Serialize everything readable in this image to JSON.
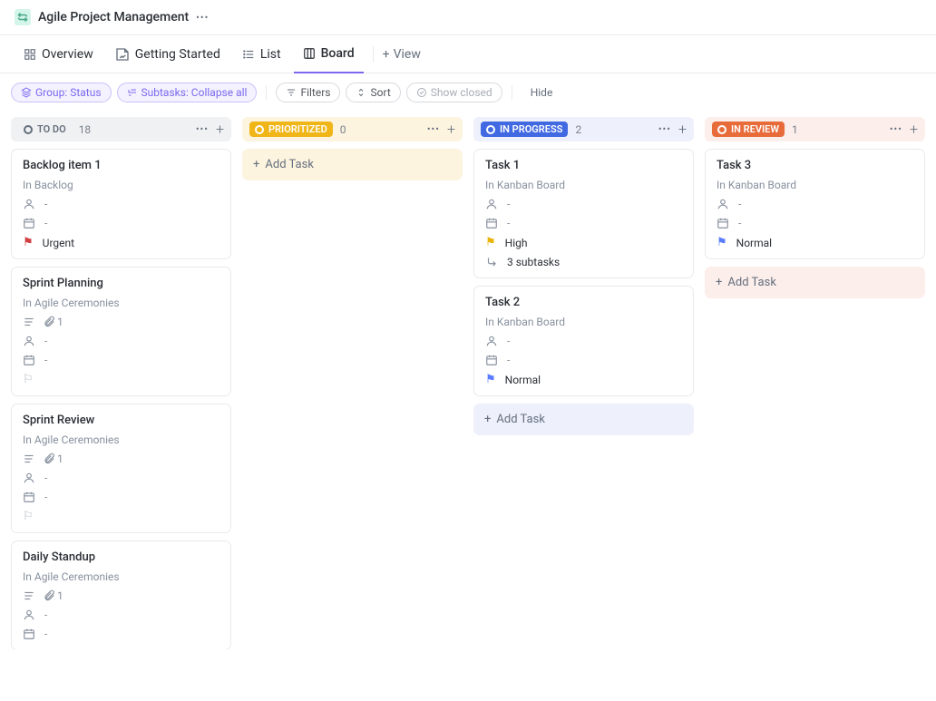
{
  "header": {
    "title": "Agile Project Management"
  },
  "tabs": {
    "overview": "Overview",
    "getting_started": "Getting Started",
    "list": "List",
    "board": "Board",
    "add_view": "View"
  },
  "toolbar": {
    "group": "Group: Status",
    "subtasks": "Subtasks: Collapse all",
    "filters": "Filters",
    "sort": "Sort",
    "show_closed": "Show closed",
    "hide": "Hide"
  },
  "add_task_label": "Add Task",
  "columns": {
    "todo": {
      "label": "TO DO",
      "count": "18"
    },
    "prioritized": {
      "label": "PRIORITIZED",
      "count": "0"
    },
    "inprogress": {
      "label": "IN PROGRESS",
      "count": "2"
    },
    "inreview": {
      "label": "IN REVIEW",
      "count": "1"
    }
  },
  "cards": {
    "todo": [
      {
        "title": "Backlog item 1",
        "loc": "In Backlog",
        "assignee": "-",
        "date": "-",
        "priority": "Urgent",
        "priority_class": "urgent"
      },
      {
        "title": "Sprint Planning",
        "loc": "In Agile Ceremonies",
        "attachments": "1",
        "assignee": "-",
        "date": "-",
        "priority": "",
        "priority_class": "none"
      },
      {
        "title": "Sprint Review",
        "loc": "In Agile Ceremonies",
        "attachments": "1",
        "assignee": "-",
        "date": "-",
        "priority": "",
        "priority_class": "none"
      },
      {
        "title": "Daily Standup",
        "loc": "In Agile Ceremonies",
        "attachments": "1",
        "assignee": "-",
        "date": "-"
      }
    ],
    "inprogress": [
      {
        "title": "Task 1",
        "loc": "In Kanban Board",
        "assignee": "-",
        "date": "-",
        "priority": "High",
        "priority_class": "high",
        "subtasks": "3 subtasks"
      },
      {
        "title": "Task 2",
        "loc": "In Kanban Board",
        "assignee": "-",
        "date": "-",
        "priority": "Normal",
        "priority_class": "normal"
      }
    ],
    "inreview": [
      {
        "title": "Task 3",
        "loc": "In Kanban Board",
        "assignee": "-",
        "date": "-",
        "priority": "Normal",
        "priority_class": "normal"
      }
    ]
  }
}
